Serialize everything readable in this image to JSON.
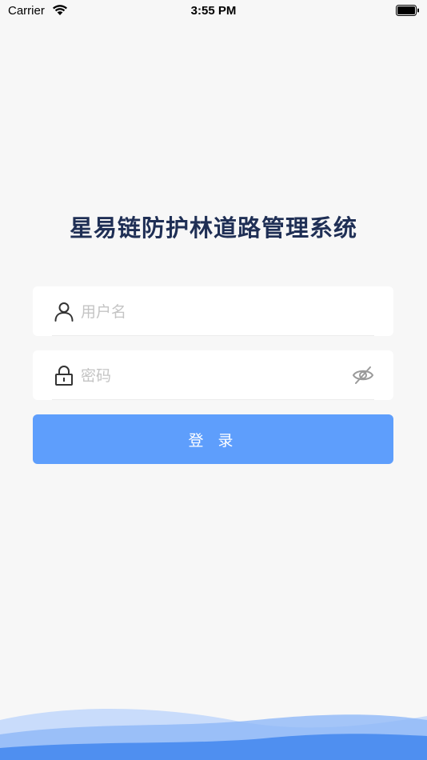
{
  "status_bar": {
    "carrier": "Carrier",
    "time": "3:55 PM"
  },
  "app_title": "星易链防护林道路管理系统",
  "form": {
    "username_placeholder": "用户名",
    "password_placeholder": "密码",
    "login_label": "登 录"
  },
  "colors": {
    "accent": "#5e9efc",
    "title": "#1f2f55",
    "background": "#f7f7f7"
  }
}
